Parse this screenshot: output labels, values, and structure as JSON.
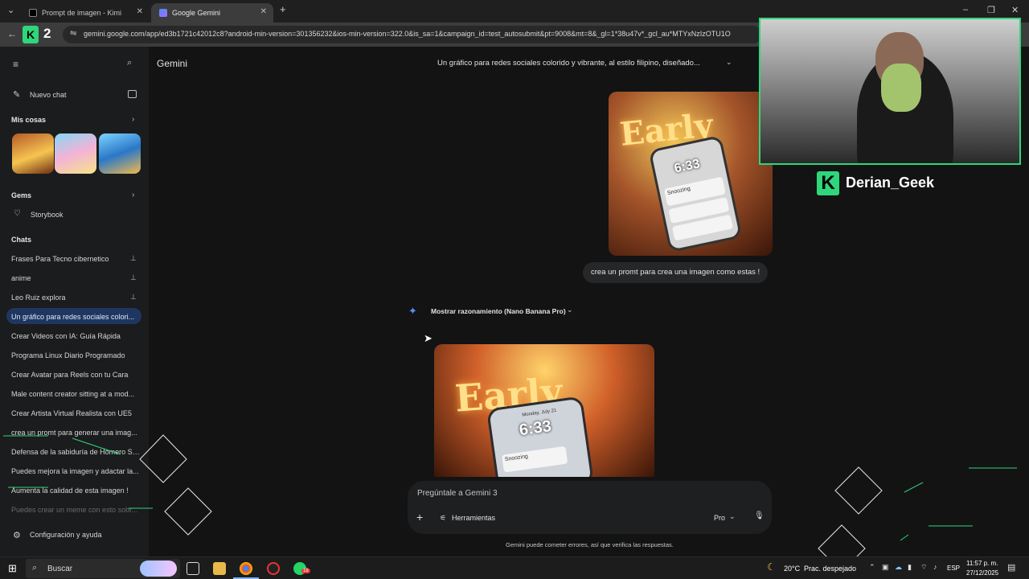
{
  "browser": {
    "tabs": [
      {
        "label": "Prompt de imagen - Kimi",
        "active": false
      },
      {
        "label": "Google Gemini",
        "active": true
      }
    ],
    "url": "gemini.google.com/app/ed3b1721c42012c8?android-min-version=301356232&ios-min-version=322.0&is_sa=1&campaign_id=test_autosubmit&pt=9008&mt=8&_gl=1*38u47v*_gcl_au*MTYxNzIzOTU1O",
    "ext_label": "2"
  },
  "sidebar": {
    "new_chat": "Nuevo chat",
    "my_stuff": "Mis cosas",
    "gems_header": "Gems",
    "gems": [
      "Storybook"
    ],
    "chats_header": "Chats",
    "chats": [
      {
        "label": "Frases Para Tecno cibernetico",
        "pinned": true
      },
      {
        "label": "anime",
        "pinned": true
      },
      {
        "label": "Leo Ruiz explora",
        "pinned": true
      },
      {
        "label": "Un gráfico para redes sociales colori...",
        "pinned": false,
        "active": true
      },
      {
        "label": "Crear Videos con IA: Guía Rápida",
        "pinned": false
      },
      {
        "label": "Programa Linux Diario Programado",
        "pinned": false
      },
      {
        "label": "Crear Avatar para Reels con tu Cara",
        "pinned": false
      },
      {
        "label": "Male content creator sitting at a mod...",
        "pinned": false
      },
      {
        "label": "Crear Artista Virtual Realista con UE5",
        "pinned": false
      },
      {
        "label": "crea un promt para generar una imag...",
        "pinned": false
      },
      {
        "label": "Defensa de la sabiduría de Homero Si...",
        "pinned": false
      },
      {
        "label": "Puedes mejora la imagen y adactar la...",
        "pinned": false
      },
      {
        "label": "Aumenta la calidad de esta imagen !",
        "pinned": false
      },
      {
        "label": "Puedes crear un meme con esto sobr...",
        "pinned": false
      }
    ],
    "settings": "Configuración y ayuda"
  },
  "main": {
    "app_title": "Gemini",
    "conversation_title": "Un gráfico para redes sociales colorido y vibrante, al estilo filipino, diseñado...",
    "user_image_title": "Early",
    "user_image_time": "6:33",
    "user_image_notif1": "Snoozing",
    "user_message": "crea un promt para crea una imagen como estas !",
    "reasoning_toggle": "Mostrar razonamiento (Nano Banana Pro)",
    "result_image_title": "Early",
    "result_image_date": "Monday, July 21",
    "result_image_time": "6:33",
    "result_image_notif": "Snoozing",
    "input_placeholder": "Pregúntale a Gemini 3",
    "tools_label": "Herramientas",
    "model_label": "Pro",
    "disclaimer": "Gemini puede cometer errores, así que verifica las respuestas."
  },
  "stream_overlay": {
    "name": "Derian_Geek",
    "logo_letter": "K"
  },
  "taskbar": {
    "search": "Buscar",
    "weather_temp": "20°C",
    "weather_desc": "Prac. despejado",
    "lang": "ESP",
    "time": "11:57 p. m.",
    "date": "27/12/2025",
    "whatsapp_badge": "18"
  },
  "colors": {
    "accent": "#2fd67b",
    "active_chat": "#1f3760",
    "bg": "#131314"
  }
}
